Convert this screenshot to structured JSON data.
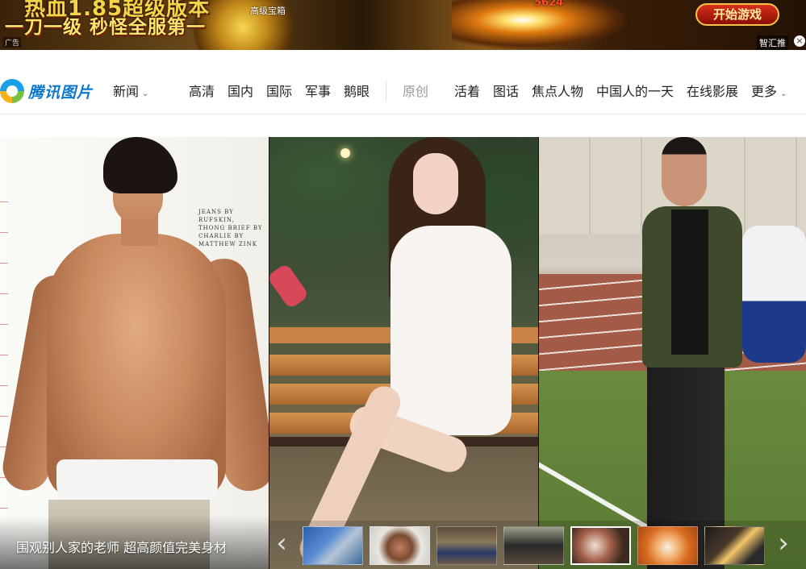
{
  "ad": {
    "headline_top": "热血1.85超级版本",
    "headline_main": "一刀一级 秒怪全服第一",
    "ad_tag": "广告",
    "treasure_label": "高级宝箱",
    "damage_number": "5624",
    "cta_label": "开始游戏",
    "brand": "智汇推",
    "close_glyph": "×"
  },
  "nav": {
    "logo_text": "腾讯图片",
    "news_label": "新闻",
    "news_caret": "⌄",
    "items_left": [
      "高清",
      "国内",
      "国际",
      "军事",
      "鹅眼"
    ],
    "original_label": "原创",
    "items_right": [
      "活着",
      "图话",
      "焦点人物",
      "中国人的一天",
      "在线影展"
    ],
    "more_label": "更多",
    "more_caret": "⌄"
  },
  "gallery": {
    "photo_credit": "JEANS BY RUFSKIN, THONG BRIEF BY CHARLIE BY MATTHEW ZINK",
    "caption": "围观别人家的老师 超高颜值完美身材",
    "prev_arrow": "‹",
    "next_arrow": "›",
    "thumbnails": [
      {
        "name": "thumb-1",
        "active": false
      },
      {
        "name": "thumb-2",
        "active": false
      },
      {
        "name": "thumb-3",
        "active": false
      },
      {
        "name": "thumb-4",
        "active": false
      },
      {
        "name": "thumb-5",
        "active": true
      },
      {
        "name": "thumb-6",
        "active": false
      },
      {
        "name": "thumb-7",
        "active": false
      }
    ]
  }
}
